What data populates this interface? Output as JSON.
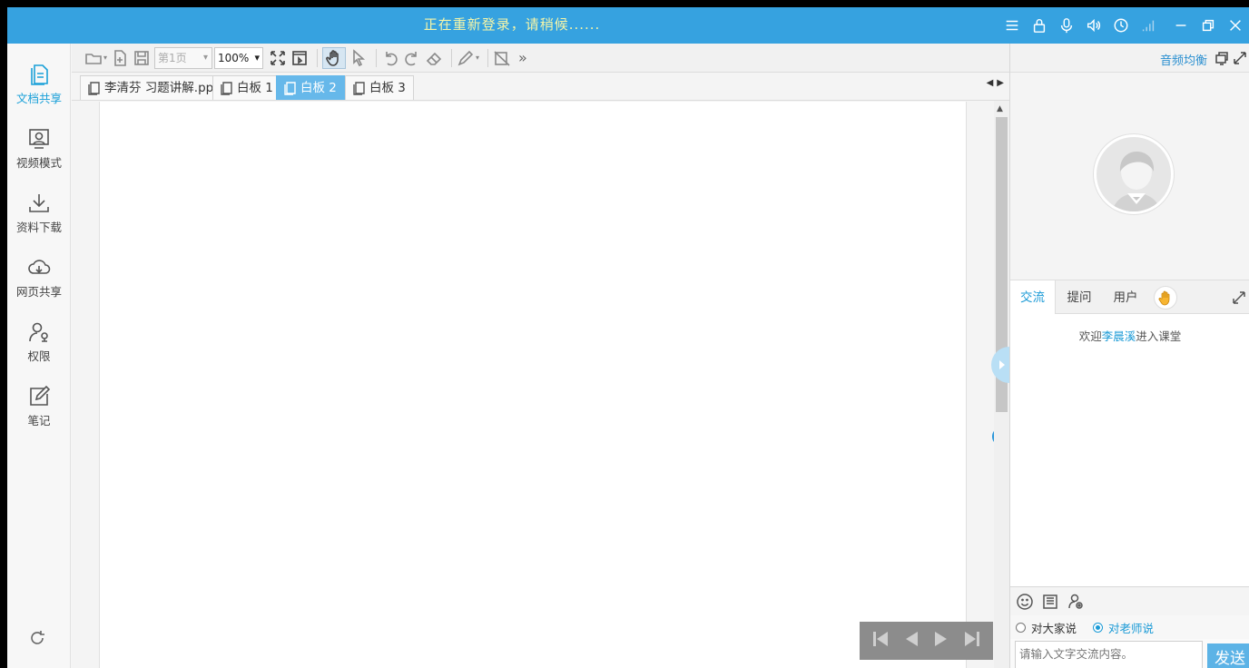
{
  "titlebar": {
    "status_text": "正在重新登录，请稍候......",
    "icons": [
      "menu-icon",
      "lock-icon",
      "microphone-icon",
      "speaker-icon",
      "clock-icon",
      "signal-icon",
      "minimize-icon",
      "restore-icon",
      "close-icon"
    ]
  },
  "sidebar": {
    "items": [
      {
        "label": "文档共享",
        "icon": "document-icon",
        "active": true
      },
      {
        "label": "视频模式",
        "icon": "video-mode-icon",
        "active": false
      },
      {
        "label": "资料下载",
        "icon": "download-icon",
        "active": false
      },
      {
        "label": "网页共享",
        "icon": "web-share-icon",
        "active": false
      },
      {
        "label": "权限",
        "icon": "permission-icon",
        "active": false
      },
      {
        "label": "笔记",
        "icon": "note-icon",
        "active": false
      }
    ],
    "refresh_icon": "refresh-icon"
  },
  "toolbar": {
    "page_value": "第1页",
    "zoom_value": "100%"
  },
  "doc_tabs": [
    {
      "label": "李清芬 习题讲解.ppt",
      "active": false
    },
    {
      "label": "白板 1",
      "active": false
    },
    {
      "label": "白板 2",
      "active": true
    },
    {
      "label": "白板 3",
      "active": false
    }
  ],
  "right_panel": {
    "audio_eq_link": "音频均衡",
    "chat_tabs": [
      {
        "label": "交流",
        "active": true
      },
      {
        "label": "提问",
        "active": false
      },
      {
        "label": "用户",
        "active": false
      }
    ],
    "welcome_prefix": "欢迎",
    "welcome_name": "李晨溪",
    "welcome_suffix": "进入课堂",
    "radio_all": "对大家说",
    "radio_teacher": "对老师说",
    "radio_selected": "teacher",
    "input_placeholder": "请输入文字交流内容。",
    "send_label": "发送"
  },
  "colors": {
    "titlebar": "#36a2e0",
    "accent": "#1a9ad6",
    "send_button": "#5cb3e6"
  }
}
